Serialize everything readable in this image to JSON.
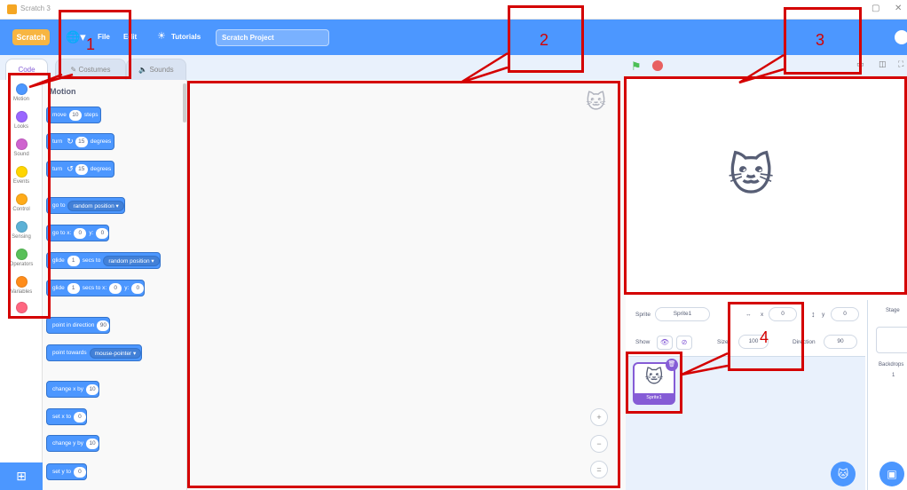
{
  "window": {
    "title": "Scratch 3",
    "controls": [
      "—",
      "▢",
      "✕"
    ]
  },
  "menubar": {
    "logo": "Scratch",
    "globe_icon": "🌐▾",
    "items": [
      "File",
      "Edit",
      "Tutorials"
    ],
    "tutorials_icon": "☀",
    "project_title": "Scratch Project"
  },
  "tabs": {
    "code": "Code",
    "costumes": "Costumes",
    "sounds": "Sounds"
  },
  "categories": [
    {
      "label": "Motion",
      "color": "#4c97ff"
    },
    {
      "label": "Looks",
      "color": "#9966ff"
    },
    {
      "label": "Sound",
      "color": "#cf63cf"
    },
    {
      "label": "Events",
      "color": "#ffd500"
    },
    {
      "label": "Control",
      "color": "#ffab19"
    },
    {
      "label": "Sensing",
      "color": "#5cb1d6"
    },
    {
      "label": "Operators",
      "color": "#59c059"
    },
    {
      "label": "Variables",
      "color": "#ff8c1a"
    },
    {
      "label": "",
      "color": "#ff6680"
    }
  ],
  "palette": {
    "heading": "Motion",
    "blocks": {
      "move": {
        "pre": "move",
        "n1": "10",
        "post": "steps"
      },
      "turn_right": {
        "pre": "turn",
        "icon": "↻",
        "n1": "15",
        "post": "degrees"
      },
      "turn_left": {
        "pre": "turn",
        "icon": "↺",
        "n1": "15",
        "post": "degrees"
      },
      "go_to": {
        "pre": "go to",
        "drop": "random position ▾"
      },
      "go_to_xy": {
        "pre": "go to x:",
        "n1": "0",
        "mid": "y:",
        "n2": "0"
      },
      "glide_to": {
        "pre": "glide",
        "n1": "1",
        "mid": "secs to",
        "drop": "random position ▾"
      },
      "glide_xy": {
        "pre": "glide",
        "n1": "1",
        "mid": "secs to x:",
        "n2": "0",
        "mid2": "y:",
        "n3": "0"
      },
      "point_dir": {
        "pre": "point in direction",
        "n1": "90"
      },
      "point_towards": {
        "pre": "point towards",
        "drop": "mouse-pointer ▾"
      },
      "change_x": {
        "pre": "change x by",
        "n1": "10"
      },
      "set_x": {
        "pre": "set x to",
        "n1": "0"
      },
      "change_y": {
        "pre": "change y by",
        "n1": "10"
      },
      "set_y": {
        "pre": "set y to",
        "n1": "0"
      }
    }
  },
  "workspace": {
    "zoom_in": "+",
    "zoom_out": "−",
    "zoom_reset": "="
  },
  "stage_header": {
    "flag_icon": "⚑",
    "layout_icons": [
      "▭",
      "◫",
      "⛶"
    ]
  },
  "sprite_info": {
    "sprite_label": "Sprite",
    "sprite_name": "Sprite1",
    "x_label": "x",
    "x_value": "0",
    "y_label": "y",
    "y_value": "0",
    "show_label": "Show",
    "size_label": "Size",
    "size_value": "100",
    "direction_label": "Direction",
    "direction_value": "90"
  },
  "sprite_list": {
    "tile_name": "Sprite1",
    "delete_icon": "🗑"
  },
  "stage_pane": {
    "title": "Stage",
    "backdrops_label": "Backdrops",
    "backdrops_count": "1"
  },
  "annotations": [
    "1",
    "2",
    "3",
    "4"
  ]
}
